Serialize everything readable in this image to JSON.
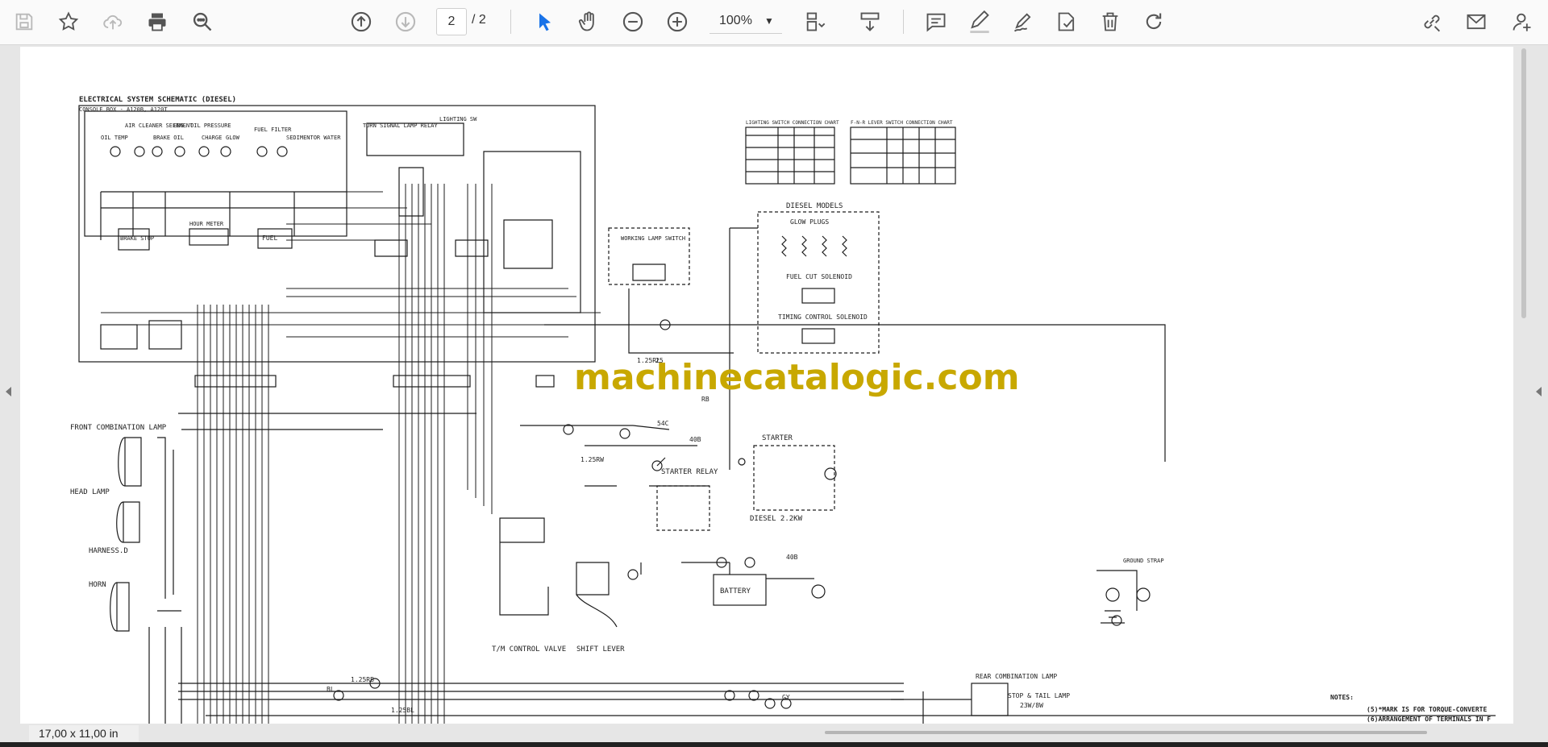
{
  "toolbar": {
    "page_current": "2",
    "page_total": "/ 2",
    "zoom": "100%",
    "icons": [
      "save-icon",
      "bookmark-star-icon",
      "upload-cloud-icon",
      "print-icon",
      "zoom-search-icon",
      "page-up-icon",
      "page-down-icon",
      "cursor-icon",
      "hand-icon",
      "zoom-out-icon",
      "zoom-in-icon",
      "page-fit-icon",
      "scroll-mode-icon",
      "comment-icon",
      "pen-icon",
      "sign-icon",
      "stamp-icon",
      "delete-icon",
      "redo-icon",
      "link-icon",
      "mail-icon",
      "add-user-icon"
    ]
  },
  "document": {
    "watermark": "machinecatalogic.com",
    "title": "ELECTRICAL SYSTEM SCHEMATIC (DIESEL)",
    "subtitle": "CONSOLE BOX - A120B, A120T",
    "labels": {
      "oil_temp": "OIL TEMP",
      "air_cleaner": "AIR CLEANER SELEMENT",
      "engine_oil": "ENG. OIL PRESSURE",
      "brake_oil": "BRAKE OIL",
      "charge": "CHARGE",
      "glow": "GLOW",
      "fuel_filter": "FUEL FILTER",
      "sedimentor": "SEDIMENTOR WATER",
      "brake_stop": "BRAKE STOP",
      "hour_meter": "HOUR METER",
      "fuel": "FUEL",
      "turn_signal_relay": "TURN SIGNAL LAMP RELAY",
      "lighting_sw": "LIGHTING SW",
      "working_lamp_switch": "WORKING LAMP SWITCH",
      "diesel_models": "DIESEL MODELS",
      "glow_plugs": "GLOW PLUGS",
      "fuel_cut": "FUEL CUT SOLENOID",
      "timing_control": "TIMING CONTROL SOLENOID",
      "front_combination": "FRONT COMBINATION LAMP",
      "head_lamp": "HEAD LAMP",
      "harness_d": "HARNESS.D",
      "horn": "HORN",
      "starter": "STARTER",
      "starter_relay": "STARTER RELAY",
      "diesel_kw": "DIESEL 2.2KW",
      "battery": "BATTERY",
      "tm_control": "T/M CONTROL VALVE",
      "shift_lever": "SHIFT LEVER",
      "ground_strap": "GROUND STRAP",
      "rear_combination": "REAR COMBINATION LAMP",
      "stop_tail": "STOP & TAIL LAMP",
      "stop_tail_w": "23W/8W",
      "notes": "NOTES:",
      "note5": "(5)*MARK IS FOR TORQUE-CONVERTE",
      "note6": "(6)ARRANGEMENT OF TERMINALS IN F",
      "lighting_chart": "LIGHTING SWITCH CONNECTION CHART",
      "fnr_chart": "F-N-R LEVER SWITCH CONNECTION CHART",
      "wire_125rl": "1.25RL",
      "wire_125rb": "1.25RB",
      "wire_125bl": "1.25BL",
      "wire_rb": "RB",
      "wire_54c": "54C",
      "wire_40b": "40B",
      "wire_40b2": "40B",
      "wire_125rw": "1.25RW",
      "wire_bl": "BL",
      "wire_gy": "GY",
      "wire_25": "25"
    }
  },
  "status": {
    "page_size": "17,00 x 11,00 in"
  }
}
